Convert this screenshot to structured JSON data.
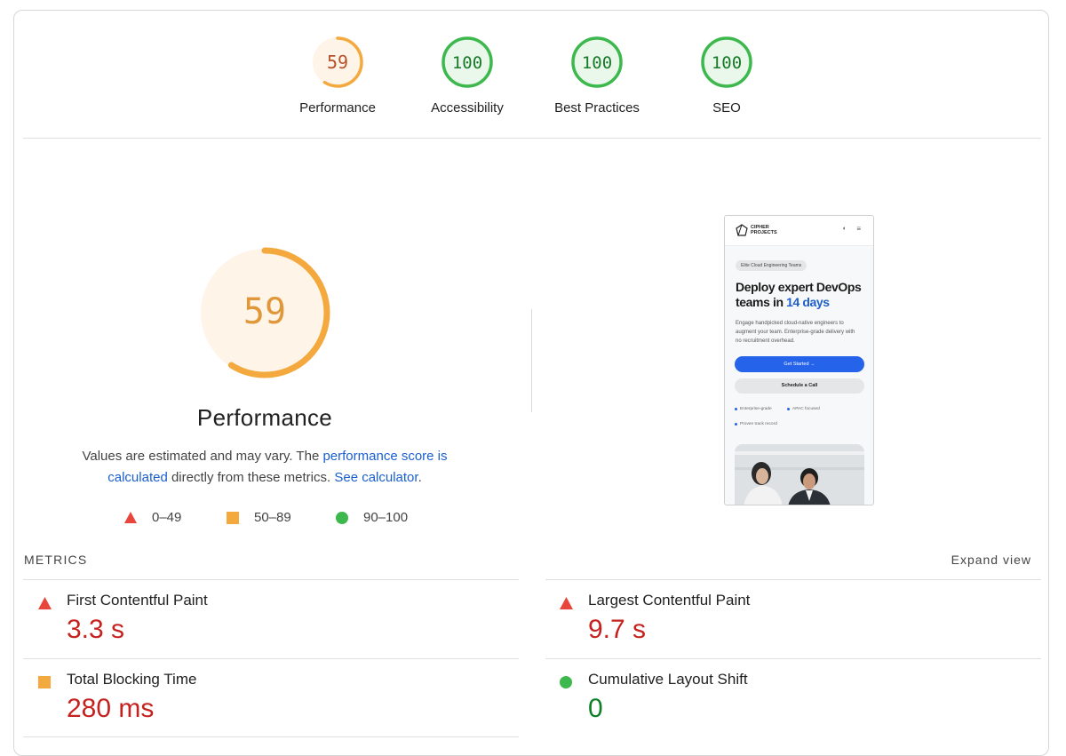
{
  "scores": [
    {
      "label": "Performance",
      "score": 59,
      "rating": "average"
    },
    {
      "label": "Accessibility",
      "score": 100,
      "rating": "pass"
    },
    {
      "label": "Best Practices",
      "score": 100,
      "rating": "pass"
    },
    {
      "label": "SEO",
      "score": 100,
      "rating": "pass"
    }
  ],
  "main": {
    "score": 59,
    "title": "Performance",
    "description": {
      "text_before": "Values are estimated and may vary. The ",
      "link1": "performance score is calculated",
      "text_middle": " directly from these metrics. ",
      "link2": "See calculator",
      "text_after": "."
    },
    "legend": [
      {
        "icon": "triangle-fail-icon",
        "label": "0–49"
      },
      {
        "icon": "square-average-icon",
        "label": "50–89"
      },
      {
        "icon": "circle-pass-icon",
        "label": "90–100"
      }
    ]
  },
  "screenshot": {
    "logo_line1": "CIPHER",
    "logo_line2": "PROJECTS",
    "pill": "Elite Cloud Engineering Teams",
    "headline": "Deploy expert DevOps teams in ",
    "headline_accent": "14 days",
    "body": "Engage handpicked cloud-native engineers to augment your team. Enterprise-grade delivery with no recruitment overhead.",
    "primary_btn": "Get Started →",
    "secondary_btn": "Schedule a Call",
    "features": [
      "Enterprise-grade",
      "APAC focused",
      "Proven track record"
    ]
  },
  "metrics": {
    "heading": "METRICS",
    "expand": "Expand view",
    "items": [
      {
        "label": "First Contentful Paint",
        "value": "3.3 s",
        "rating": "fail"
      },
      {
        "label": "Largest Contentful Paint",
        "value": "9.7 s",
        "rating": "fail"
      },
      {
        "label": "Total Blocking Time",
        "value": "280 ms",
        "rating": "average"
      },
      {
        "label": "Cumulative Layout Shift",
        "value": "0",
        "rating": "pass"
      }
    ]
  },
  "colors": {
    "fail": "#c5221f",
    "average": "#f4a93e",
    "pass": "#3cb84d",
    "link": "#1a5fd0"
  }
}
